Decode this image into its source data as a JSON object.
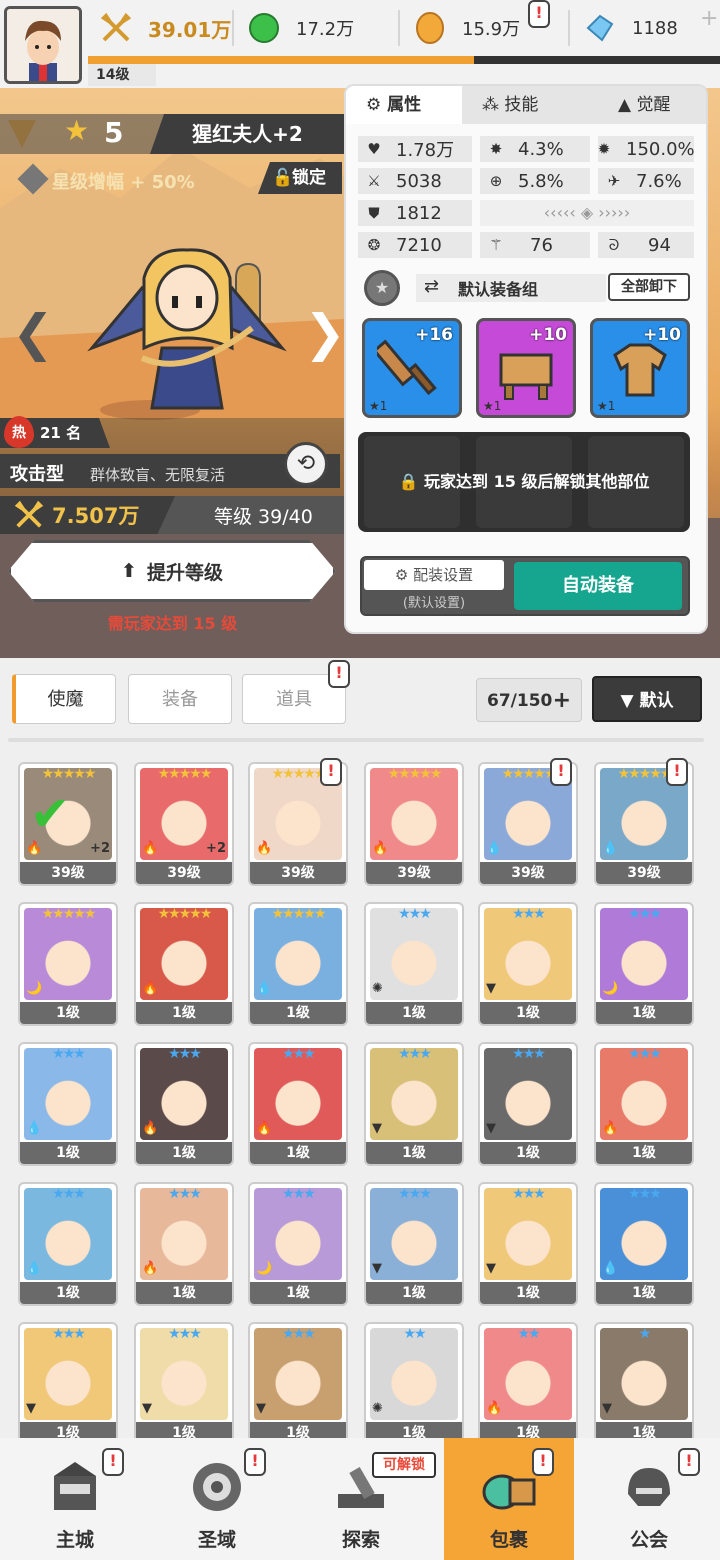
{
  "topbar": {
    "player_level": "14级",
    "level_progress": 0.61,
    "power": "39.01万",
    "green_currency": "17.2万",
    "gold_currency": "15.9万",
    "gems": "1188",
    "alert": "!"
  },
  "hero": {
    "stars": "5",
    "name": "猩红夫人+2",
    "boost": "星级增幅 + 50%",
    "lock_label": "锁定",
    "rank_icon": "热",
    "rank": "21 名",
    "type": "攻击型",
    "tags": "群体致盲、无限复活",
    "power": "7.507万",
    "level": "等级 39/40",
    "upgrade_label": "提升等级",
    "upgrade_note": "需玩家达到 15 级"
  },
  "panel": {
    "tabs": [
      "属性",
      "技能",
      "觉醒"
    ],
    "stats": {
      "hp": "1.78万",
      "crit": "4.3%",
      "crit_dmg": "150.0%",
      "atk": "5038",
      "acc": "5.8%",
      "speed": "7.6%",
      "def": "1812",
      "mp": "7210",
      "stat_a": "76",
      "stat_b": "94"
    },
    "equip_group": "默认装备组",
    "unequip_all": "全部卸下",
    "slots": [
      {
        "plus": "+16",
        "star": "★1",
        "color": "#2a8fe8"
      },
      {
        "plus": "+10",
        "star": "★1",
        "color": "#c64ad8"
      },
      {
        "plus": "+10",
        "star": "★1",
        "color": "#2a8fe8"
      }
    ],
    "locked_msg": "玩家达到 15 级后解锁其他部位",
    "config_label": "配装设置",
    "config_sub": "(默认设置)",
    "auto_equip": "自动装备"
  },
  "inventory": {
    "tabs": [
      "使魔",
      "装备",
      "道具"
    ],
    "count": "67/150",
    "sort_label": "▼ 默认",
    "cards": [
      {
        "stars": "★★★★★",
        "level": "39级",
        "color": "#9a8a7a",
        "el": "🔥",
        "plus": "+2"
      },
      {
        "stars": "★★★★★",
        "level": "39级",
        "color": "#e86a6a",
        "el": "🔥",
        "plus": "+2"
      },
      {
        "stars": "★★★★★",
        "level": "39级",
        "color": "#f0d8c8",
        "el": "🔥",
        "plus": ""
      },
      {
        "stars": "★★★★★",
        "level": "39级",
        "color": "#f08a8a",
        "el": "🔥",
        "plus": ""
      },
      {
        "stars": "★★★★★",
        "level": "39级",
        "color": "#8aa8d8",
        "el": "💧",
        "plus": ""
      },
      {
        "stars": "★★★★★",
        "level": "39级",
        "color": "#7aa8c8",
        "el": "💧",
        "plus": ""
      },
      {
        "stars": "★★★★★",
        "level": "1级",
        "color": "#b88ad8",
        "el": "🌙",
        "plus": ""
      },
      {
        "stars": "★★★★★",
        "level": "1级",
        "color": "#d8584a",
        "el": "🔥",
        "plus": ""
      },
      {
        "stars": "★★★★★",
        "level": "1级",
        "color": "#7ab0e0",
        "el": "💧",
        "plus": ""
      },
      {
        "stars": "★★★",
        "level": "1级",
        "color": "#e0e0e0",
        "el": "✺",
        "plus": ""
      },
      {
        "stars": "★★★",
        "level": "1级",
        "color": "#f0c87a",
        "el": "▼",
        "plus": ""
      },
      {
        "stars": "★★★",
        "level": "1级",
        "color": "#b07ad8",
        "el": "🌙",
        "plus": ""
      },
      {
        "stars": "★★★",
        "level": "1级",
        "color": "#8ab8e8",
        "el": "💧",
        "plus": ""
      },
      {
        "stars": "★★★",
        "level": "1级",
        "color": "#5a4a4a",
        "el": "🔥",
        "plus": ""
      },
      {
        "stars": "★★★",
        "level": "1级",
        "color": "#e05a5a",
        "el": "🔥",
        "plus": ""
      },
      {
        "stars": "★★★",
        "level": "1级",
        "color": "#d8c078",
        "el": "▼",
        "plus": ""
      },
      {
        "stars": "★★★",
        "level": "1级",
        "color": "#6a6a6a",
        "el": "▼",
        "plus": ""
      },
      {
        "stars": "★★★",
        "level": "1级",
        "color": "#e87a6a",
        "el": "🔥",
        "plus": ""
      },
      {
        "stars": "★★★",
        "level": "1级",
        "color": "#7ab8e0",
        "el": "💧",
        "plus": ""
      },
      {
        "stars": "★★★",
        "level": "1级",
        "color": "#e8b89a",
        "el": "🔥",
        "plus": ""
      },
      {
        "stars": "★★★",
        "level": "1级",
        "color": "#b89ad8",
        "el": "🌙",
        "plus": ""
      },
      {
        "stars": "★★★",
        "level": "1级",
        "color": "#8ab0d8",
        "el": "▼",
        "plus": ""
      },
      {
        "stars": "★★★",
        "level": "1级",
        "color": "#f0c87a",
        "el": "▼",
        "plus": ""
      },
      {
        "stars": "★★★",
        "level": "1级",
        "color": "#4a90d8",
        "el": "💧",
        "plus": ""
      },
      {
        "stars": "★★★",
        "level": "1级",
        "color": "#f0c878",
        "el": "▼",
        "plus": ""
      },
      {
        "stars": "★★★",
        "level": "1级",
        "color": "#f0dca8",
        "el": "▼",
        "plus": ""
      },
      {
        "stars": "★★★",
        "level": "1级",
        "color": "#c8a070",
        "el": "▼",
        "plus": ""
      },
      {
        "stars": "★★",
        "level": "1级",
        "color": "#d8d8d8",
        "el": "✺",
        "plus": ""
      },
      {
        "stars": "★★",
        "level": "1级",
        "color": "#f08a8a",
        "el": "🔥",
        "plus": ""
      },
      {
        "stars": "★",
        "level": "1级",
        "color": "#8a7a6a",
        "el": "▼",
        "plus": ""
      }
    ]
  },
  "bottom_nav": {
    "items": [
      "主城",
      "圣域",
      "探索",
      "包裹",
      "公会"
    ],
    "unlock_tag": "可解锁"
  }
}
